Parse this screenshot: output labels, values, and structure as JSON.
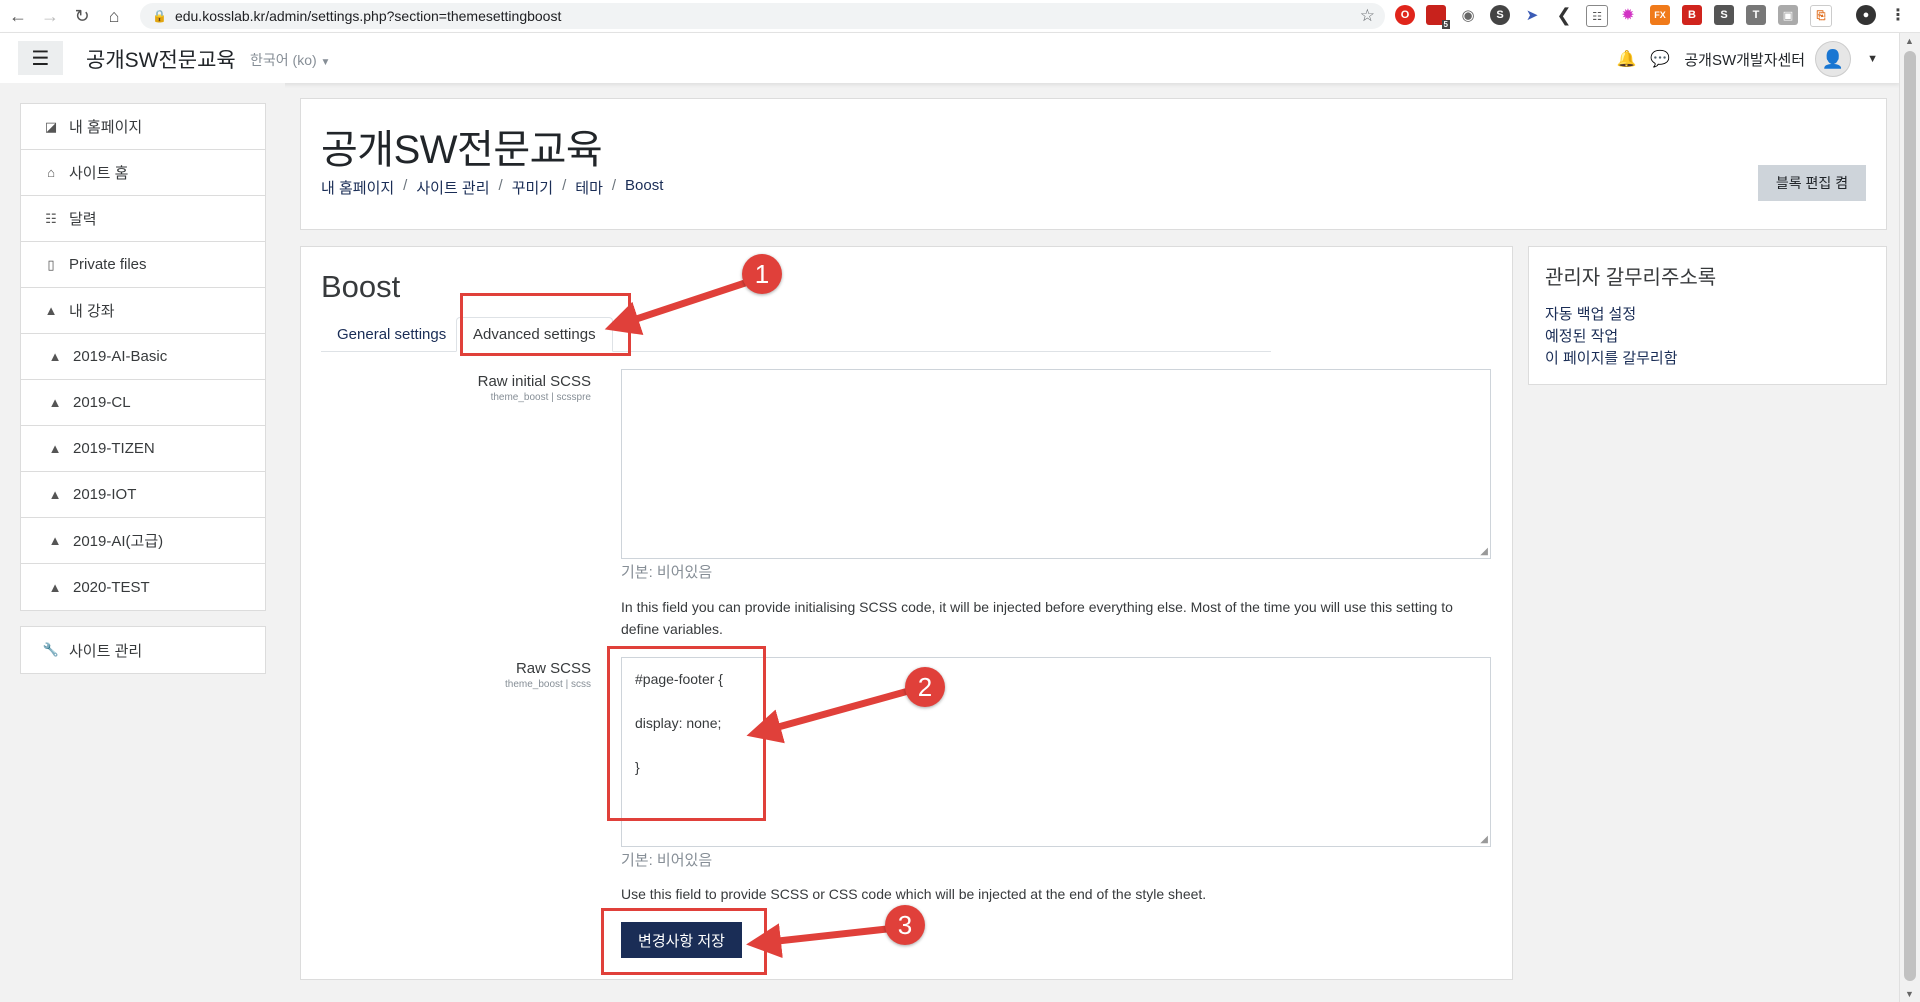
{
  "browser": {
    "url": "edu.kosslab.kr/admin/settings.php?section=themesettingboost",
    "back_icon": "arrow-left",
    "forward_icon": "arrow-right",
    "reload_icon": "reload",
    "home_icon": "home",
    "ext_badge": "5"
  },
  "navbar": {
    "site_name": "공개SW전문교육",
    "language": "한국어 (ko)",
    "user_name": "공개SW개발자센터"
  },
  "drawer": {
    "items": [
      {
        "label": "내 홈페이지",
        "icon": "dashboard-icon"
      },
      {
        "label": "사이트 홈",
        "icon": "home-icon"
      },
      {
        "label": "달력",
        "icon": "calendar-icon"
      },
      {
        "label": "Private files",
        "icon": "file-icon"
      },
      {
        "label": "내 강좌",
        "icon": "graduation-cap-icon"
      },
      {
        "label": "2019-AI-Basic",
        "icon": "graduation-cap-icon"
      },
      {
        "label": "2019-CL",
        "icon": "graduation-cap-icon"
      },
      {
        "label": "2019-TIZEN",
        "icon": "graduation-cap-icon"
      },
      {
        "label": "2019-IOT",
        "icon": "graduation-cap-icon"
      },
      {
        "label": "2019-AI(고급)",
        "icon": "graduation-cap-icon"
      },
      {
        "label": "2020-TEST",
        "icon": "graduation-cap-icon"
      }
    ],
    "site_admin": "사이트 관리"
  },
  "header": {
    "title": "공개SW전문교육",
    "breadcrumbs": [
      "내 홈페이지",
      "사이트 관리",
      "꾸미기",
      "테마",
      "Boost"
    ],
    "edit_button": "블록 편집 켬"
  },
  "main": {
    "heading": "Boost",
    "tabs": [
      "General settings",
      "Advanced settings"
    ],
    "raw_initial": {
      "label": "Raw initial SCSS",
      "sub": "theme_boost | scsspre",
      "value": "",
      "default": "기본: 비어있음",
      "description": "In this field you can provide initialising SCSS code, it will be injected before everything else. Most of the time you will use this setting to define variables."
    },
    "raw_scss": {
      "label": "Raw SCSS",
      "sub": "theme_boost | scss",
      "value": "#page-footer {\n\ndisplay: none;\n\n}",
      "default": "기본: 비어있음",
      "description": "Use this field to provide SCSS or CSS code which will be injected at the end of the style sheet."
    },
    "save_button": "변경사항 저장"
  },
  "admin_block": {
    "title": "관리자 갈무리주소록",
    "links": [
      "자동 백업 설정",
      "예정된 작업",
      "이 페이지를 갈무리함"
    ]
  },
  "annotations": {
    "badges": [
      "1",
      "2",
      "3"
    ],
    "color": "#e0403a"
  },
  "colors": {
    "primary": "#1a2d56",
    "muted": "#868e96",
    "background": "#f2f2f2"
  }
}
